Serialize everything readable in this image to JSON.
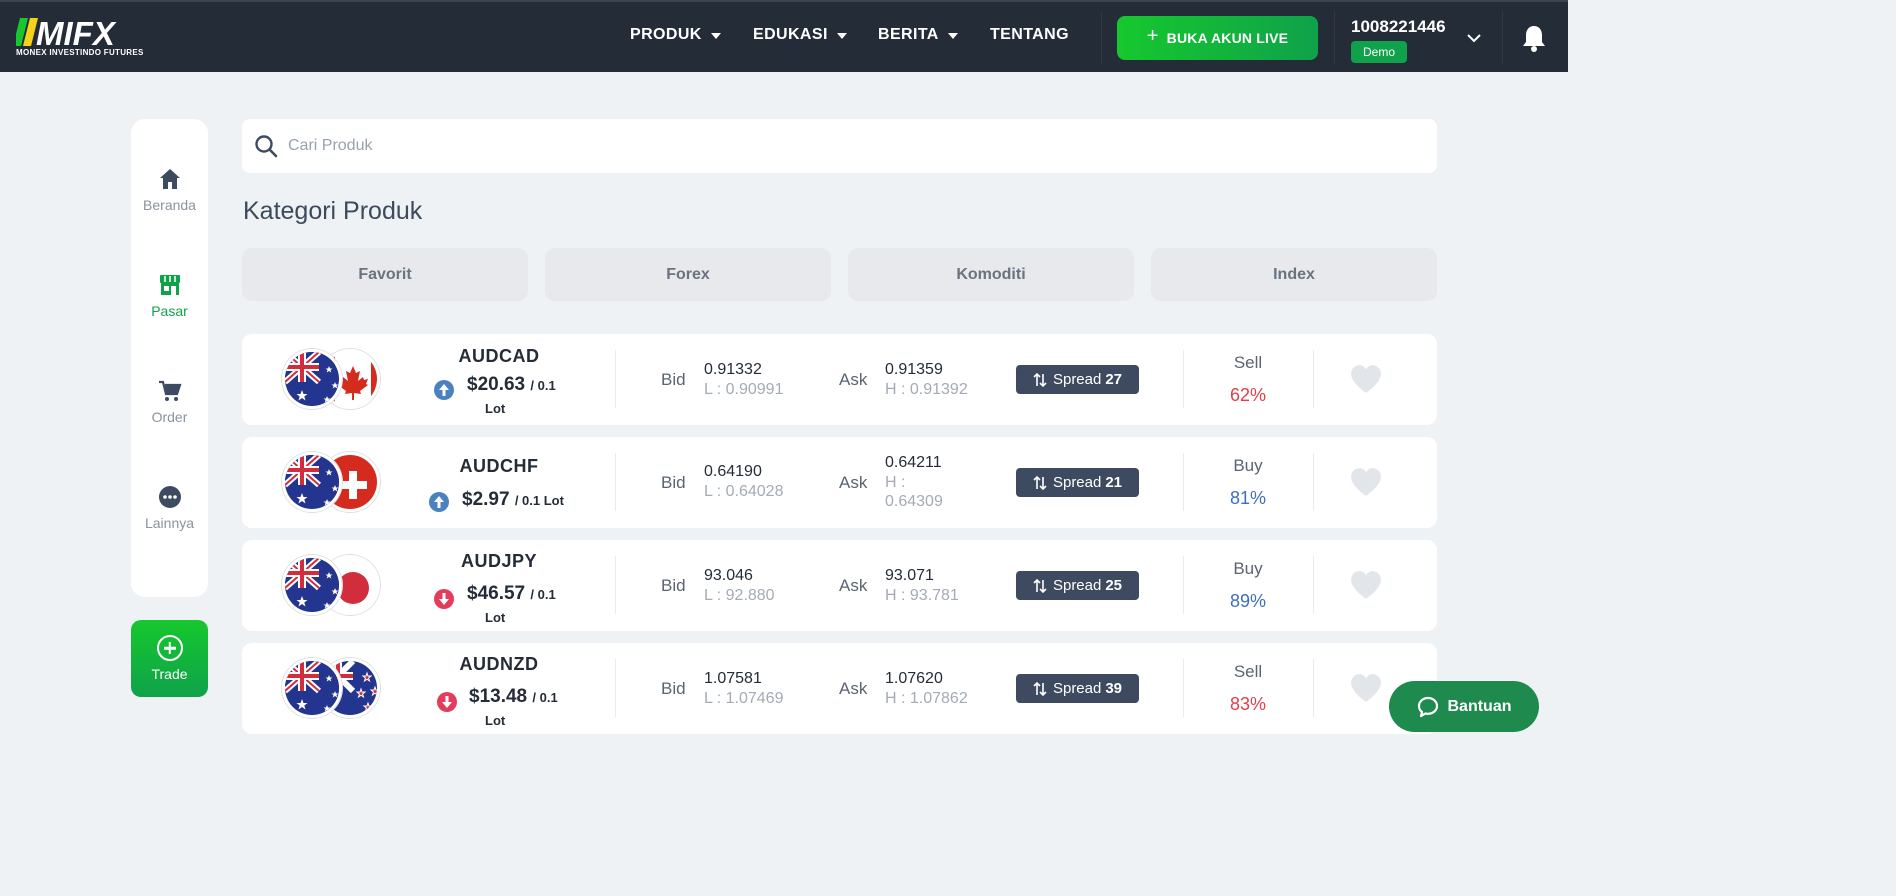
{
  "header": {
    "logo_text": "MIFX",
    "logo_subtitle": "MONEX INVESTINDO FUTURES",
    "nav": [
      {
        "label": "PRODUK",
        "dropdown": true
      },
      {
        "label": "EDUKASI",
        "dropdown": true
      },
      {
        "label": "BERITA",
        "dropdown": true
      },
      {
        "label": "TENTANG",
        "dropdown": false
      }
    ],
    "live_button": "BUKA AKUN LIVE",
    "account_number": "1008221446",
    "account_type": "Demo"
  },
  "sidebar": {
    "items": [
      {
        "label": "Beranda",
        "icon": "home-icon"
      },
      {
        "label": "Pasar",
        "icon": "store-icon",
        "active": true
      },
      {
        "label": "Order",
        "icon": "cart-icon"
      },
      {
        "label": "Lainnya",
        "icon": "more-icon"
      }
    ],
    "trade_button": "Trade"
  },
  "search": {
    "placeholder": "Cari Produk"
  },
  "category_title": "Kategori Produk",
  "categories": [
    "Favorit",
    "Forex",
    "Komoditi",
    "Index"
  ],
  "products": [
    {
      "pair": "AUDCAD",
      "direction": "up",
      "price": "$20.63",
      "unit": "/ 0.1",
      "lot": "Lot",
      "bid_label": "Bid",
      "bid": "0.91332",
      "low": "L : 0.90991",
      "ask_label": "Ask",
      "ask": "0.91359",
      "high": "H : 0.91392",
      "spread_label": "Spread",
      "spread": "27",
      "side": "Sell",
      "pct": "62%"
    },
    {
      "pair": "AUDCHF",
      "direction": "up",
      "price": "$2.97",
      "unit": "/ 0.1 Lot",
      "lot": "",
      "bid_label": "Bid",
      "bid": "0.64190",
      "low": "L : 0.64028",
      "ask_label": "Ask",
      "ask": "0.64211",
      "high": "H : 0.64309",
      "spread_label": "Spread",
      "spread": "21",
      "side": "Buy",
      "pct": "81%"
    },
    {
      "pair": "AUDJPY",
      "direction": "down",
      "price": "$46.57",
      "unit": "/ 0.1",
      "lot": "Lot",
      "bid_label": "Bid",
      "bid": "93.046",
      "low": "L : 92.880",
      "ask_label": "Ask",
      "ask": "93.071",
      "high": "H : 93.781",
      "spread_label": "Spread",
      "spread": "25",
      "side": "Buy",
      "pct": "89%"
    },
    {
      "pair": "AUDNZD",
      "direction": "down",
      "price": "$13.48",
      "unit": "/ 0.1",
      "lot": "Lot",
      "bid_label": "Bid",
      "bid": "1.07581",
      "low": "L : 1.07469",
      "ask_label": "Ask",
      "ask": "1.07620",
      "high": "H : 1.07862",
      "spread_label": "Spread",
      "spread": "39",
      "side": "Sell",
      "pct": "83%"
    }
  ],
  "help_button": "Bantuan",
  "colors": {
    "topbar": "#232c37",
    "green": "#0fa24a",
    "sell": "#e43d4a",
    "buy": "#3d70b8",
    "spread_badge": "#3d4a5f"
  }
}
